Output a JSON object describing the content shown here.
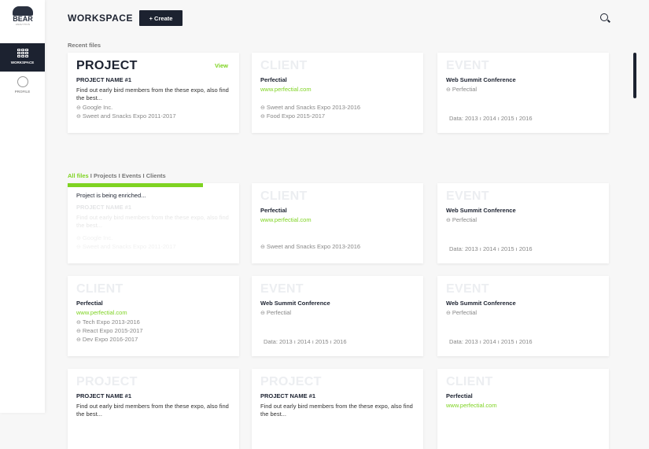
{
  "sidebar": {
    "logo_title": "BEAR",
    "logo_sub": "ANALYTICS",
    "items": [
      {
        "label": "WORKSPACE"
      },
      {
        "label": "PROFILE"
      }
    ]
  },
  "header": {
    "title": "WORKSPACE",
    "create_label": "+ Create"
  },
  "recent_label": "Recent files",
  "filters": [
    "All files",
    "Projects",
    "Events",
    "Clients"
  ],
  "filter_sep": " I ",
  "enrich": {
    "text": "Project is being enriched...",
    "progress": 0.79
  },
  "colors": {
    "accent": "#7ed321",
    "dark": "#1c2230"
  },
  "cards": [
    {
      "type": "PROJECT",
      "dark": true,
      "view": "View",
      "title": "PROJECT NAME #1",
      "desc": "Find out early bird members from the these expo, also find the best...",
      "links": [
        "Google Inc.",
        "Sweet and Snacks Expo 2011-2017"
      ]
    },
    {
      "type": "CLIENT",
      "title": "Perfectial",
      "url": "www.perfectial.com",
      "links": [
        "Sweet and Snacks Expo 2013-2016",
        "Food Expo 2015-2017"
      ]
    },
    {
      "type": "EVENT",
      "title": "Web Summit Conference",
      "toplinks": [
        "Perfectial"
      ],
      "data": "Data: 2013 ı 2014 ı 2015 ı 2016"
    },
    {
      "type": "",
      "enriching": true,
      "title": "PROJECT NAME #1",
      "desc": "Find out early bird members from the these expo, also find the best...",
      "links": [
        "Google Inc.",
        "Sweet and Snacks Expo 2011-2017"
      ]
    },
    {
      "type": "CLIENT",
      "title": "Perfectial",
      "url": "www.perfectial.com",
      "links": [
        "Sweet and Snacks Expo 2013-2016"
      ]
    },
    {
      "type": "EVENT",
      "title": "Web Summit Conference",
      "toplinks": [
        "Perfectial"
      ],
      "data": "Data: 2013 ı 2014 ı 2015 ı 2016"
    },
    {
      "type": "CLIENT",
      "title": "Perfectial",
      "url": "www.perfectial.com",
      "links": [
        "Tech Expo 2013-2016",
        "React Expo 2015-2017",
        "Dev Expo 2016-2017"
      ]
    },
    {
      "type": "EVENT",
      "title": "Web Summit Conference",
      "toplinks": [
        "Perfectial"
      ],
      "data": "Data: 2013 ı 2014 ı 2015 ı 2016"
    },
    {
      "type": "EVENT",
      "title": "Web Summit Conference",
      "toplinks": [
        "Perfectial"
      ],
      "data": "Data: 2013 ı 2014 ı 2015 ı 2016"
    },
    {
      "type": "PROJECT",
      "title": "PROJECT NAME #1",
      "desc": "Find out early bird members from the these expo, also find the best..."
    },
    {
      "type": "PROJECT",
      "title": "PROJECT NAME #1",
      "desc": "Find out early bird members from the these expo, also find the best..."
    },
    {
      "type": "CLIENT",
      "title": "Perfectial",
      "url": "www.perfectial.com"
    }
  ]
}
